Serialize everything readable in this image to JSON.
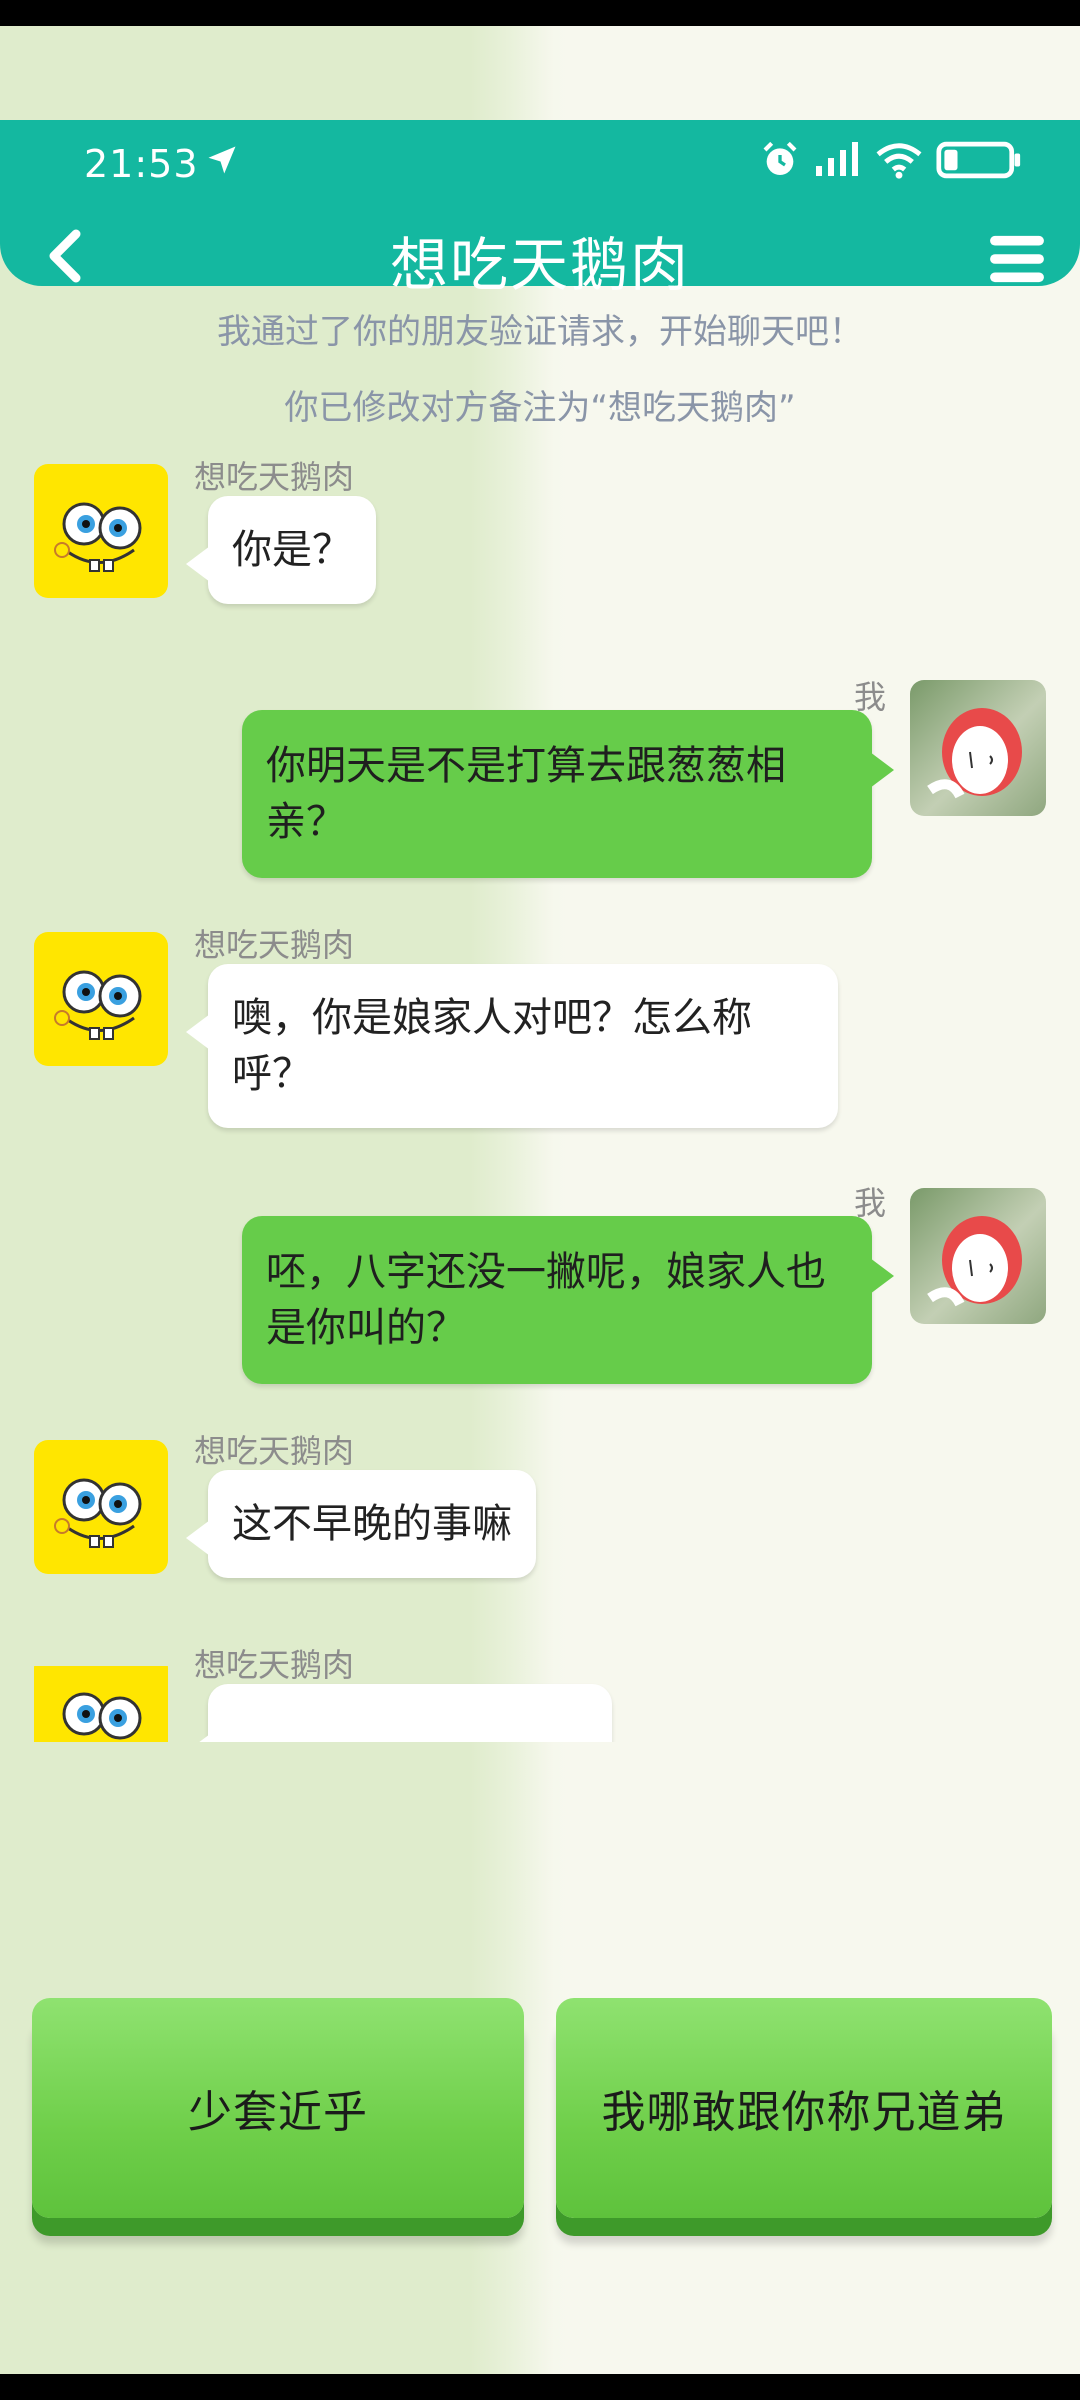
{
  "status_bar": {
    "time": "21:53"
  },
  "header": {
    "title": "想吃天鹅肉"
  },
  "system_messages": [
    "我通过了你的朋友验证请求，开始聊天吧！",
    "你已修改对方备注为“想吃天鹅肉”"
  ],
  "messages": [
    {
      "sender": "想吃天鹅肉",
      "side": "left",
      "text": "你是？"
    },
    {
      "sender": "我",
      "side": "right",
      "text": "你明天是不是打算去跟葱葱相亲？"
    },
    {
      "sender": "想吃天鹅肉",
      "side": "left",
      "text": "噢，你是娘家人对吧？怎么称呼？"
    },
    {
      "sender": "我",
      "side": "right",
      "text": "呸，八字还没一撇呢，娘家人也是你叫的？"
    },
    {
      "sender": "想吃天鹅肉",
      "side": "left",
      "text": "这不早晚的事嘛"
    },
    {
      "sender": "想吃天鹅肉",
      "side": "left",
      "text": ""
    }
  ],
  "choices": [
    "少套近乎",
    "我哪敢跟你称兄道弟"
  ],
  "colors": {
    "header": "#14b8a0",
    "my_bubble": "#66cc4a",
    "choice_button": "#6fcf4a"
  }
}
